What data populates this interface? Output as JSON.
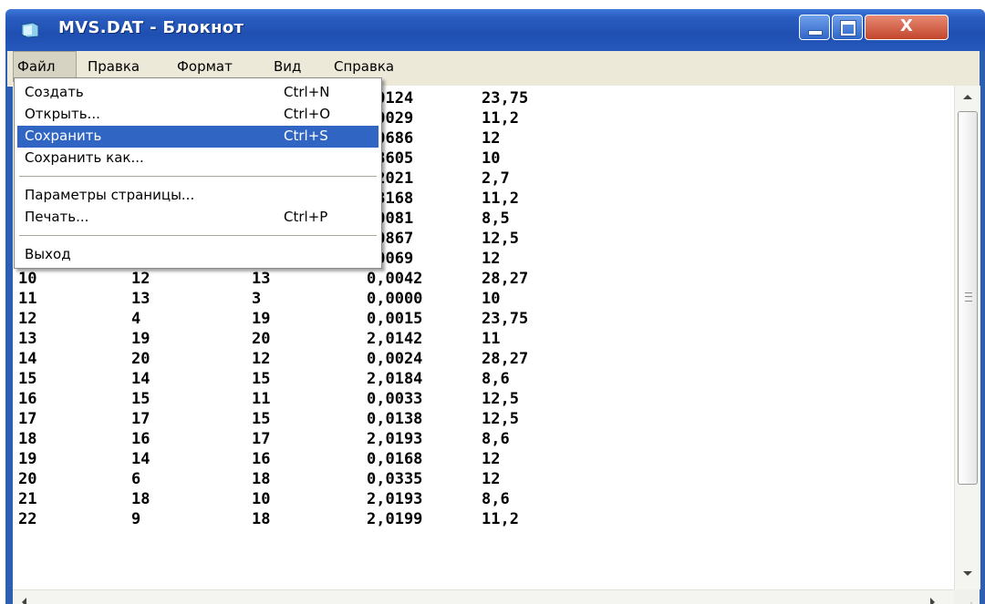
{
  "window": {
    "title": "MVS.DAT - Блокнот",
    "close_glyph": "X",
    "colors": {
      "titlebar": "#2a5cc0",
      "menubar": "#ece9d8",
      "selection": "#3165c4",
      "close_button": "#c2462c"
    }
  },
  "menubar": {
    "items": [
      {
        "label": "Файл"
      },
      {
        "label": "Правка"
      },
      {
        "label": "Формат"
      },
      {
        "label": "Вид"
      },
      {
        "label": "Справка"
      }
    ]
  },
  "file_menu": {
    "items": [
      {
        "label": "Создать",
        "shortcut": "Ctrl+N"
      },
      {
        "label": "Открыть...",
        "shortcut": "Ctrl+O"
      },
      {
        "label": "Сохранить",
        "shortcut": "Ctrl+S",
        "selected": true
      },
      {
        "label": "Сохранить как...",
        "shortcut": ""
      },
      {
        "label": "Параметры страницы...",
        "shortcut": ""
      },
      {
        "label": "Печать...",
        "shortcut": "Ctrl+P"
      },
      {
        "label": "Выход",
        "shortcut": ""
      }
    ]
  },
  "document": {
    "rows": [
      {
        "c1": "",
        "c2": "",
        "c3": "",
        "c4": ",0124",
        "c5": "23,75"
      },
      {
        "c1": "",
        "c2": "",
        "c3": "",
        "c4": ",0029",
        "c5": "11,2"
      },
      {
        "c1": "",
        "c2": "",
        "c3": "",
        "c4": ",0686",
        "c5": "12"
      },
      {
        "c1": "",
        "c2": "",
        "c3": "",
        "c4": ",3605",
        "c5": "10"
      },
      {
        "c1": "",
        "c2": "",
        "c3": "",
        "c4": ",2021",
        "c5": "2,7"
      },
      {
        "c1": "",
        "c2": "",
        "c3": "",
        "c4": ",3168",
        "c5": "11,2"
      },
      {
        "c1": "",
        "c2": "",
        "c3": "",
        "c4": ",0081",
        "c5": "8,5"
      },
      {
        "c1": "",
        "c2": "",
        "c3": "",
        "c4": ",0867",
        "c5": "12,5"
      },
      {
        "c1": "",
        "c2": "",
        "c3": "",
        "c4": ",0069",
        "c5": "12"
      },
      {
        "c1": "10",
        "c2": "12",
        "c3": "13",
        "c4": "0,0042",
        "c5": "28,27"
      },
      {
        "c1": "11",
        "c2": "13",
        "c3": "3",
        "c4": "0,0000",
        "c5": "10"
      },
      {
        "c1": "12",
        "c2": "4",
        "c3": "19",
        "c4": "0,0015",
        "c5": "23,75"
      },
      {
        "c1": "13",
        "c2": "19",
        "c3": "20",
        "c4": "2,0142",
        "c5": "11"
      },
      {
        "c1": "14",
        "c2": "20",
        "c3": "12",
        "c4": "0,0024",
        "c5": "28,27"
      },
      {
        "c1": "15",
        "c2": "14",
        "c3": "15",
        "c4": "2,0184",
        "c5": "8,6"
      },
      {
        "c1": "16",
        "c2": "15",
        "c3": "11",
        "c4": "0,0033",
        "c5": "12,5"
      },
      {
        "c1": "17",
        "c2": "17",
        "c3": "15",
        "c4": "0,0138",
        "c5": "12,5"
      },
      {
        "c1": "18",
        "c2": "16",
        "c3": "17",
        "c4": "2,0193",
        "c5": "8,6"
      },
      {
        "c1": "19",
        "c2": "14",
        "c3": "16",
        "c4": "0,0168",
        "c5": "12"
      },
      {
        "c1": "20",
        "c2": "6",
        "c3": "18",
        "c4": "0,0335",
        "c5": "12"
      },
      {
        "c1": "21",
        "c2": "18",
        "c3": "10",
        "c4": "2,0193",
        "c5": "8,6"
      },
      {
        "c1": "22",
        "c2": "9",
        "c3": "18",
        "c4": "2,0199",
        "c5": "11,2"
      }
    ]
  },
  "scrollbars": {
    "up_icon": "arrow-up-icon",
    "down_icon": "arrow-down-icon",
    "left_icon": "arrow-left-icon",
    "right_icon": "arrow-right-icon"
  }
}
